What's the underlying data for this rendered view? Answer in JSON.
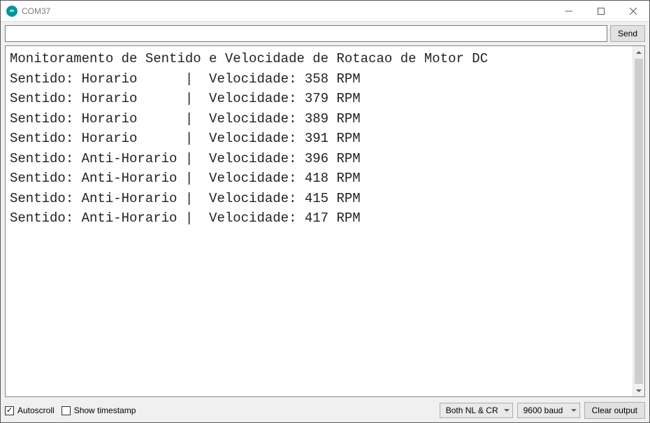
{
  "window": {
    "title": "COM37"
  },
  "toolbar": {
    "send_label": "Send",
    "input_value": ""
  },
  "console": {
    "header": "Monitoramento de Sentido e Velocidade de Rotacao de Motor DC",
    "rows": [
      {
        "sentido": "Horario",
        "rpm": 358
      },
      {
        "sentido": "Horario",
        "rpm": 379
      },
      {
        "sentido": "Horario",
        "rpm": 389
      },
      {
        "sentido": "Horario",
        "rpm": 391
      },
      {
        "sentido": "Anti-Horario",
        "rpm": 396
      },
      {
        "sentido": "Anti-Horario",
        "rpm": 418
      },
      {
        "sentido": "Anti-Horario",
        "rpm": 415
      },
      {
        "sentido": "Anti-Horario",
        "rpm": 417
      }
    ],
    "label_sentido": "Sentido:",
    "label_velocidade": "Velocidade:",
    "unit": "RPM"
  },
  "footer": {
    "autoscroll_label": "Autoscroll",
    "autoscroll_checked": true,
    "timestamp_label": "Show timestamp",
    "timestamp_checked": false,
    "line_ending": "Both NL & CR",
    "baud": "9600 baud",
    "clear_label": "Clear output"
  }
}
